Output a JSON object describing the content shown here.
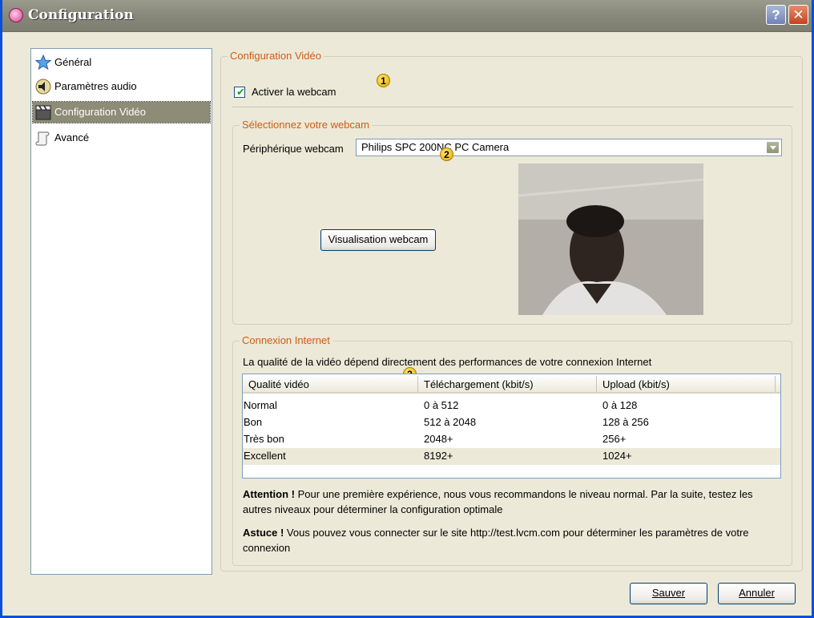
{
  "window": {
    "title": "Configuration",
    "help_label": "?",
    "close_label": "✕"
  },
  "sidebar": {
    "items": [
      {
        "label": "Général",
        "icon": "star-icon"
      },
      {
        "label": "Paramètres audio",
        "icon": "speaker-icon"
      },
      {
        "label": "Configuration Vidéo",
        "icon": "clapperboard-icon",
        "selected": true
      },
      {
        "label": "Avancé",
        "icon": "scroll-icon"
      }
    ]
  },
  "video": {
    "group_title": "Configuration Vidéo",
    "enable_webcam_label": "Activer la webcam",
    "enable_webcam_checked": true,
    "badge1": "1",
    "select_group_title": "Sélectionnez votre webcam",
    "device_label": "Périphérique webcam",
    "device_value": "Philips SPC 200NC PC Camera",
    "badge2": "2",
    "preview_button": "Visualisation webcam"
  },
  "internet": {
    "group_title": "Connexion Internet",
    "intro": "La qualité de la vidéo dépend directement des performances de votre connexion Internet",
    "badge3": "3",
    "columns": [
      "Qualité vidéo",
      "Téléchargement (kbit/s)",
      "Upload (kbit/s)"
    ],
    "rows": [
      [
        "Normal",
        "0 à 512",
        "0 à 128"
      ],
      [
        "Bon",
        "512 à 2048",
        "128 à 256"
      ],
      [
        "Très bon",
        "2048+",
        "256+"
      ],
      [
        "Excellent",
        "8192+",
        "1024+"
      ]
    ],
    "selected_row": 3,
    "attention_title": "Attention !",
    "attention_text": " Pour une première expérience, nous vous recommandons le niveau normal. Par la suite, testez les autres niveaux pour déterminer la configuration optimale",
    "tip_title": "Astuce !",
    "tip_text": " Vous pouvez vous connecter sur le site http://test.lvcm.com pour déterminer les paramètres de votre connexion"
  },
  "footer": {
    "save_label": "Sauver",
    "cancel_label": "Annuler"
  },
  "colors": {
    "group_title": "#d05c14",
    "selected_nav": "#8c8c77",
    "window_bg": "#ece9d8"
  }
}
